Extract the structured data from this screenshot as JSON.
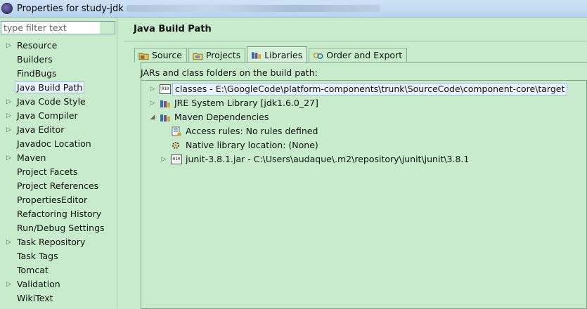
{
  "window": {
    "title": "Properties for study-jdk"
  },
  "filter": {
    "placeholder": "type filter text"
  },
  "sidebar": {
    "items": [
      {
        "label": "Resource",
        "expandable": true
      },
      {
        "label": "Builders",
        "expandable": false
      },
      {
        "label": "FindBugs",
        "expandable": false
      },
      {
        "label": "Java Build Path",
        "expandable": false,
        "selected": true
      },
      {
        "label": "Java Code Style",
        "expandable": true
      },
      {
        "label": "Java Compiler",
        "expandable": true
      },
      {
        "label": "Java Editor",
        "expandable": true
      },
      {
        "label": "Javadoc Location",
        "expandable": false
      },
      {
        "label": "Maven",
        "expandable": true
      },
      {
        "label": "Project Facets",
        "expandable": false
      },
      {
        "label": "Project References",
        "expandable": false
      },
      {
        "label": "PropertiesEditor",
        "expandable": false
      },
      {
        "label": "Refactoring History",
        "expandable": false
      },
      {
        "label": "Run/Debug Settings",
        "expandable": false
      },
      {
        "label": "Task Repository",
        "expandable": true
      },
      {
        "label": "Task Tags",
        "expandable": false
      },
      {
        "label": "Tomcat",
        "expandable": false
      },
      {
        "label": "Validation",
        "expandable": true
      },
      {
        "label": "WikiText",
        "expandable": false
      }
    ]
  },
  "main": {
    "title": "Java Build Path",
    "tabs": [
      {
        "label": "Source",
        "icon": "source-folder-icon"
      },
      {
        "label": "Projects",
        "icon": "projects-folder-icon"
      },
      {
        "label": "Libraries",
        "icon": "libraries-icon",
        "active": true
      },
      {
        "label": "Order and Export",
        "icon": "order-export-icon"
      }
    ],
    "subtitle": "JARs and class folders on the build path:",
    "entries": [
      {
        "label": "classes - E:\\GoogleCode\\platform-components\\trunk\\SourceCode\\component-core\\target",
        "icon": "class-folder-icon",
        "expander": "collapsed",
        "selected": true
      },
      {
        "label": "JRE System Library [jdk1.6.0_27]",
        "icon": "library-icon",
        "expander": "collapsed"
      },
      {
        "label": "Maven Dependencies",
        "icon": "library-icon",
        "expander": "expanded"
      },
      {
        "label": "Access rules: No rules defined",
        "icon": "access-rules-icon",
        "expander": "none"
      },
      {
        "label": "Native library location: (None)",
        "icon": "native-library-icon",
        "expander": "none"
      },
      {
        "label": "junit-3.8.1.jar - C:\\Users\\audaque\\.m2\\repository\\junit\\junit\\3.8.1",
        "icon": "jar-icon",
        "expander": "collapsed"
      }
    ]
  },
  "glyphs": {
    "collapsed": "▷",
    "expanded": "◢"
  },
  "colors": {
    "background": "#c8ebcc",
    "selection": "#eaf3ff",
    "selection_border": "#9bc0e6"
  }
}
